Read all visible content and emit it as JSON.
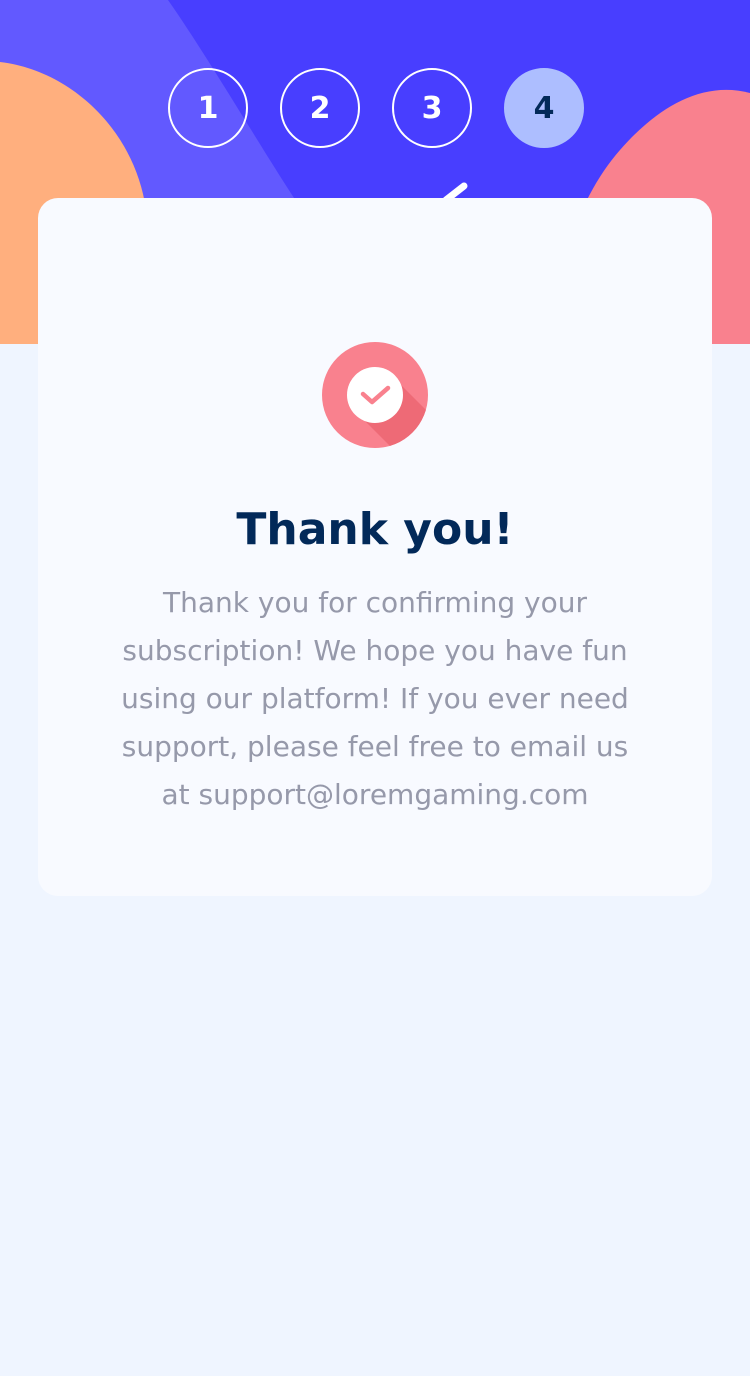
{
  "colors": {
    "hero_background": "#483EFF",
    "hero_blob_light": "#6259FF",
    "hero_blob_orange": "#FFAF7E",
    "hero_blob_pink": "#F9818E",
    "card_background": "#F8FAFF",
    "page_background": "#EFF5FF",
    "active_step": "#ADBEFF",
    "heading": "#022959",
    "body_text": "#9699AA",
    "check_circle": "#F9818E",
    "check_shadow": "#EE6A76"
  },
  "steps": [
    {
      "number": "1",
      "active": false
    },
    {
      "number": "2",
      "active": false
    },
    {
      "number": "3",
      "active": false
    },
    {
      "number": "4",
      "active": true
    }
  ],
  "confirmation": {
    "icon": "checkmark-icon",
    "title": "Thank you!",
    "message": "Thank you for confirming your subscription! We hope you have fun using our platform! If you ever need support, please feel free to email us at support@loremgaming.com"
  }
}
